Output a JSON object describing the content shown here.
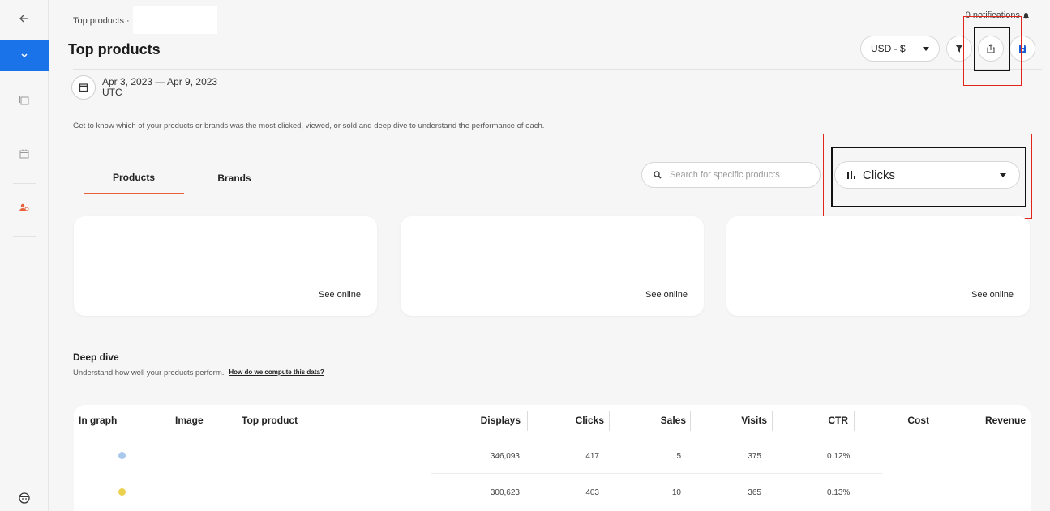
{
  "sidebar": {
    "back_icon": "arrow-left-icon",
    "active_icon": "chevron-down-icon",
    "items": [
      "copy-icon",
      "calendar-icon",
      "users-icon"
    ],
    "avatar": "avatar-icon"
  },
  "breadcrumb": {
    "label": "Top products ·"
  },
  "notifications": {
    "label": "0 notifications"
  },
  "header": {
    "title": "Top products",
    "currency": "USD - $",
    "filter_icon": "filter-icon",
    "export_icon": "export-icon",
    "save_icon": "save-icon"
  },
  "date_range": {
    "range": "Apr 3, 2023 — Apr 9, 2023",
    "timezone": "UTC"
  },
  "description": "Get to know which of your products or brands was the most clicked, viewed, or sold and deep dive to understand the performance of each.",
  "tabs": [
    {
      "label": "Products",
      "active": true
    },
    {
      "label": "Brands",
      "active": false
    }
  ],
  "search": {
    "placeholder": "Search for specific products"
  },
  "metric": {
    "value": "Clicks"
  },
  "cards": [
    {
      "link": "See online"
    },
    {
      "link": "See online"
    },
    {
      "link": "See online"
    }
  ],
  "deep_dive": {
    "title": "Deep dive",
    "subtitle": "Understand how well your products perform.",
    "link": "How do we compute this data?"
  },
  "table": {
    "columns": [
      "In graph",
      "Image",
      "Top product",
      "Displays",
      "Clicks",
      "Sales",
      "Visits",
      "CTR",
      "Cost",
      "Revenue"
    ],
    "rows": [
      {
        "dot_color": "#a9c8ee",
        "displays": "346,093",
        "clicks": "417",
        "sales": "5",
        "visits": "375",
        "ctr": "0.12%"
      },
      {
        "dot_color": "#ecd14f",
        "displays": "300,623",
        "clicks": "403",
        "sales": "10",
        "visits": "365",
        "ctr": "0.13%"
      }
    ]
  },
  "colors": {
    "accent_blue": "#1a73e8",
    "tab_underline": "#e8603c",
    "highlight_red": "#e0251b"
  }
}
